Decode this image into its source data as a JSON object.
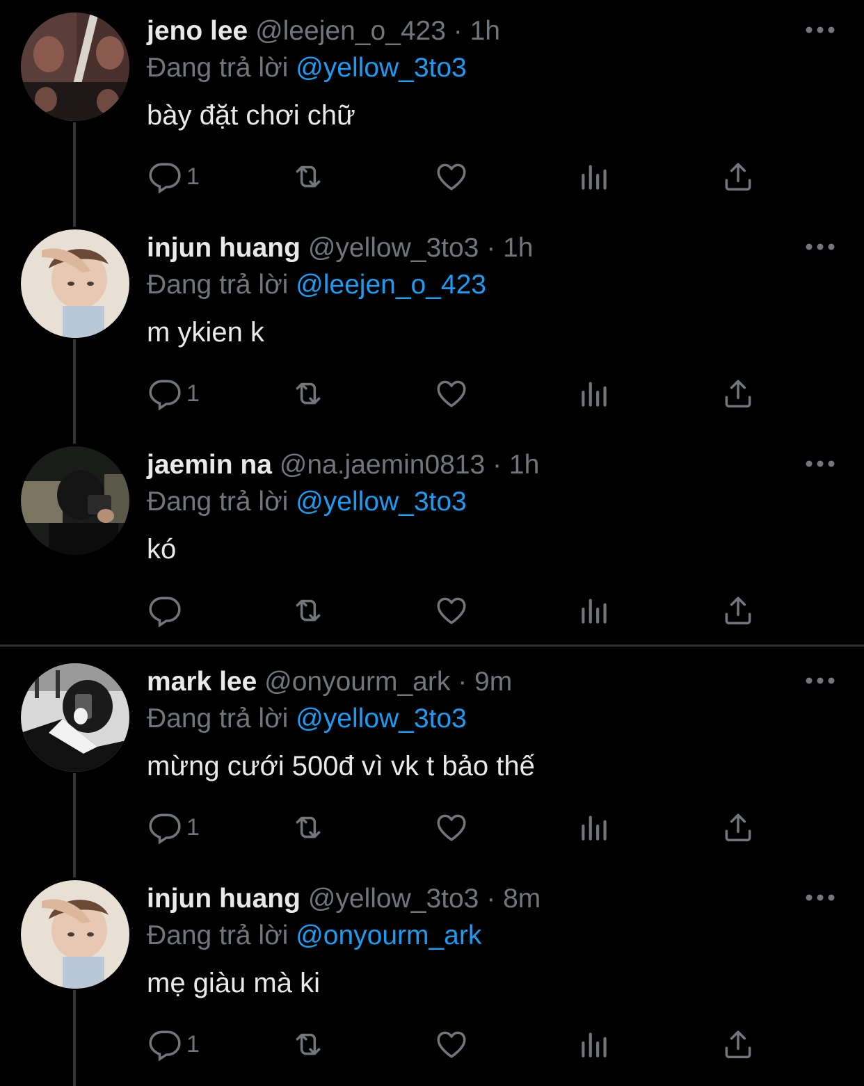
{
  "theme": {
    "background": "#000000",
    "text": "#e7e9ea",
    "muted": "#71767b",
    "accent": "#1d9bf0"
  },
  "tweets": [
    {
      "name": "jeno lee",
      "handle": "@leejen_o_423",
      "separator": "·",
      "time": "1h",
      "reply_prefix": "Đang trả lời",
      "reply_to": "@yellow_3to3",
      "text": "bày đặt chơi chữ",
      "reply_count": "1",
      "avatar_icon": "avatar-photo"
    },
    {
      "name": "injun huang",
      "handle": "@yellow_3to3",
      "separator": "·",
      "time": "1h",
      "reply_prefix": "Đang trả lời",
      "reply_to": "@leejen_o_423",
      "text": "m ykien k",
      "reply_count": "1",
      "avatar_icon": "avatar-photo"
    },
    {
      "name": "jaemin na",
      "handle": "@na.jaemin0813",
      "separator": "·",
      "time": "1h",
      "reply_prefix": "Đang trả lời",
      "reply_to": "@yellow_3to3",
      "text": "kó",
      "reply_count": "",
      "avatar_icon": "avatar-photo"
    },
    {
      "name": "mark lee",
      "handle": "@onyourm_ark",
      "separator": "·",
      "time": "9m",
      "reply_prefix": "Đang trả lời",
      "reply_to": "@yellow_3to3",
      "text": "mừng cưới 500đ vì vk t bảo thế",
      "reply_count": "1",
      "avatar_icon": "avatar-photo"
    },
    {
      "name": "injun huang",
      "handle": "@yellow_3to3",
      "separator": "·",
      "time": "8m",
      "reply_prefix": "Đang trả lời",
      "reply_to": "@onyourm_ark",
      "text": "mẹ giàu mà ki",
      "reply_count": "1",
      "avatar_icon": "avatar-photo"
    }
  ],
  "icons": [
    "reply-icon",
    "retweet-icon",
    "like-icon",
    "views-icon",
    "share-icon",
    "more-icon"
  ]
}
